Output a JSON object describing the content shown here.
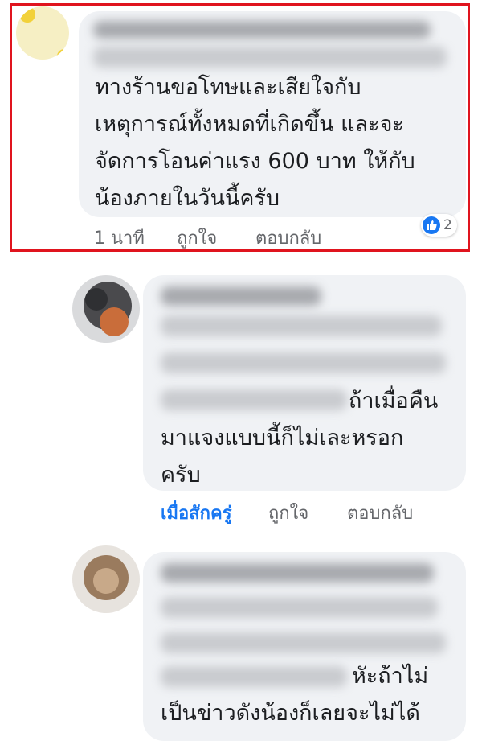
{
  "comments": [
    {
      "message": "ทางร้านขอโทษและเสียใจกับ\nเหตุการณ์ทั้งหมดที่เกิดขึ้น และจะ\nจัดการโอนค่าแรง 600 บาท ให้กับ\nน้องภายในวันนี้ครับ",
      "time": "1 นาที",
      "like_label": "ถูกใจ",
      "reply_label": "ตอบกลับ",
      "reaction_count": "2",
      "highlighted": true
    },
    {
      "message_line1": "ถ้าเมื่อคืน",
      "message_rest": "มาแจงแบบนี้ก็ไม่เละหรอก\nครับ",
      "time": "เมื่อสักครู่",
      "like_label": "ถูกใจ",
      "reply_label": "ตอบกลับ"
    },
    {
      "message_line1": "หัะถ้าไม่",
      "message_rest": "เป็นข่าวดังน้องก็เลยจะไม่ได้"
    }
  ],
  "colors": {
    "highlight_border": "#e0141e",
    "bubble": "#f0f2f5",
    "link_blue": "#1877f2",
    "meta_gray": "#65676b"
  },
  "icons": {
    "reaction": "thumbs-up-icon"
  }
}
